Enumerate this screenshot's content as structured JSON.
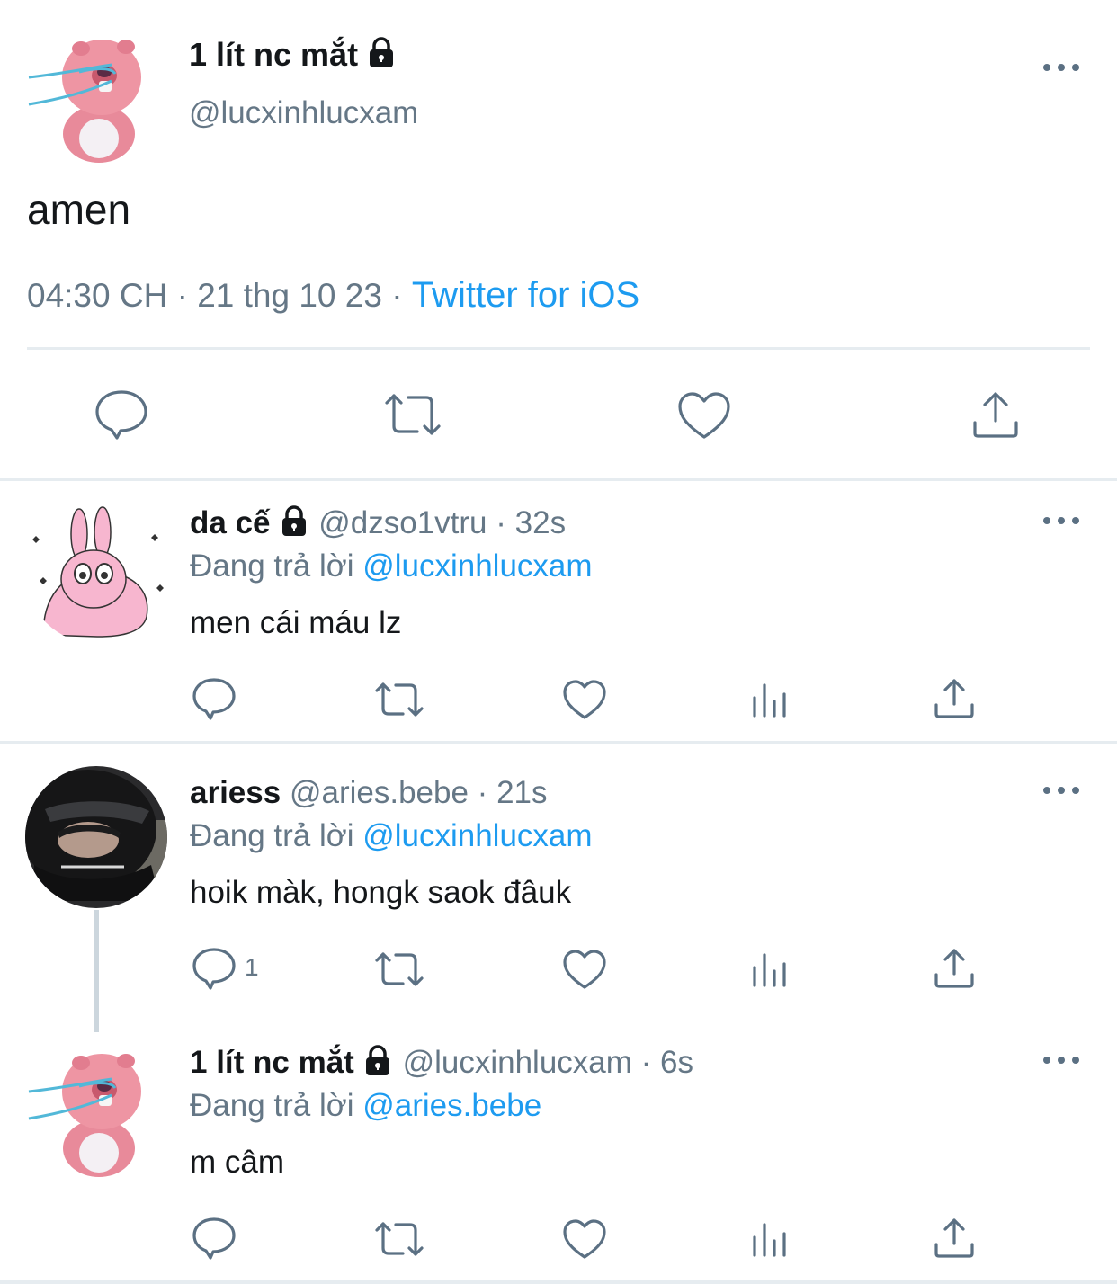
{
  "main_tweet": {
    "display_name": "1 lít nc mắt",
    "handle": "@lucxinhlucxam",
    "text": "amen",
    "time": "04:30 CH",
    "date": "21 thg 10 23",
    "source": "Twitter for iOS"
  },
  "replying_prefix": "Đang trả lời",
  "replies": [
    {
      "display_name": "da cế",
      "handle": "@dzso1vtru",
      "age": "32s",
      "reply_to": "@lucxinhlucxam",
      "text": "men cái máu lz",
      "reply_count": ""
    },
    {
      "display_name": "ariess",
      "handle": "@aries.bebe",
      "age": "21s",
      "reply_to": "@lucxinhlucxam",
      "text": "hoik màk, hongk saok đâuk",
      "reply_count": "1"
    },
    {
      "display_name": "1 lít nc mắt",
      "handle": "@lucxinhlucxam",
      "age": "6s",
      "reply_to": "@aries.bebe",
      "text": "m câm",
      "reply_count": ""
    }
  ],
  "separator": "·",
  "colors": {
    "accent": "#1d9bf0",
    "icon": "#5b7083",
    "muted": "#657786"
  }
}
